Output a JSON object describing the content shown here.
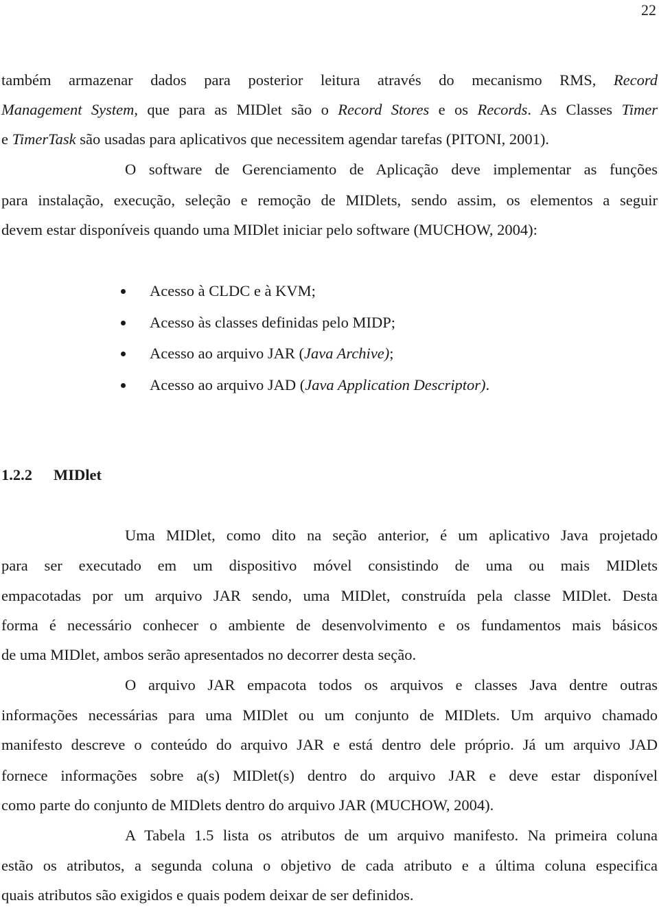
{
  "page": {
    "number": "22"
  },
  "paragraph1": {
    "lines": [
      [
        "também armazenar dados para posterior leitura através do mecanismo RMS, ",
        "Record"
      ],
      [
        "Management System",
        ", que para as MIDlet são o ",
        "Record Stores",
        " e os ",
        "Records",
        ". As Classes ",
        "Timer"
      ],
      [
        "e ",
        "TimerTask",
        " são usadas para aplicativos que necessitem agendar tarefas (PITONI, 2001)."
      ]
    ]
  },
  "paragraph2": {
    "lines": [
      "O software de Gerenciamento de Aplicação deve implementar as funções",
      "para instalação, execução, seleção e remoção de MIDlets, sendo assim, os elementos a seguir",
      "devem estar disponíveis quando uma MIDlet iniciar pelo software (MUCHOW, 2004):"
    ]
  },
  "bullets": [
    {
      "text": "Acesso à CLDC e à KVM;",
      "italic": "",
      "suffix": ""
    },
    {
      "text": "Acesso às classes definidas pelo MIDP;",
      "italic": "",
      "suffix": ""
    },
    {
      "text": "Acesso ao arquivo JAR (",
      "italic": "Java Archive)",
      "suffix": ";"
    },
    {
      "text": "Acesso ao arquivo JAD (",
      "italic": "Java Application Descriptor)",
      "suffix": "."
    }
  ],
  "section": {
    "number": "1.2.2",
    "title": "MIDlet"
  },
  "paragraph3": {
    "lines": [
      "Uma MIDlet, como dito na seção anterior, é um aplicativo Java projetado",
      "para ser executado em um dispositivo móvel consistindo de uma ou mais MIDlets",
      "empacotadas por um arquivo JAR sendo, uma MIDlet, construída pela classe MIDlet. Desta",
      "forma é necessário conhecer o ambiente de desenvolvimento e os fundamentos mais básicos",
      "de uma MIDlet, ambos serão apresentados no decorrer desta seção."
    ]
  },
  "paragraph4": {
    "lines": [
      "O arquivo JAR empacota todos os arquivos e classes Java dentre outras",
      "informações necessárias para uma MIDlet ou um conjunto de MIDlets. Um arquivo chamado",
      "manifesto descreve o conteúdo do arquivo JAR e está dentro dele próprio. Já um arquivo JAD",
      "fornece informações sobre a(s) MIDlet(s) dentro do arquivo JAR e deve estar disponível",
      "como parte do conjunto de MIDlets dentro do arquivo JAR (MUCHOW, 2004)."
    ]
  },
  "paragraph5": {
    "lines": [
      "A Tabela 1.5 lista os atributos de um arquivo manifesto. Na primeira coluna",
      "estão os atributos, a segunda coluna o objetivo de cada atributo e a última coluna especifica",
      "quais atributos são exigidos e quais podem deixar de ser definidos."
    ]
  }
}
